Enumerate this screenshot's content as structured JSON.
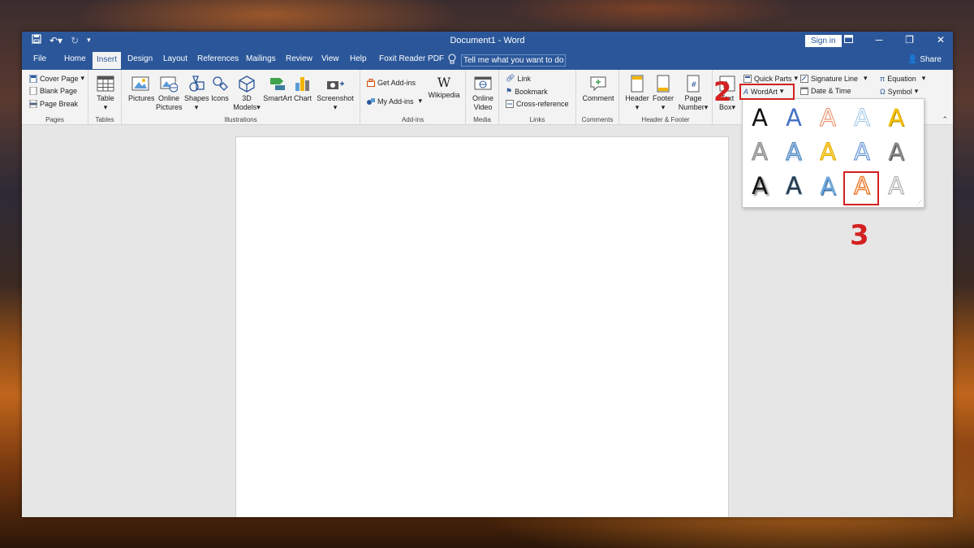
{
  "titlebar": {
    "doc_title": "Document1  -  Word",
    "sign_in": "Sign in"
  },
  "tabs": [
    "File",
    "Home",
    "Insert",
    "Design",
    "Layout",
    "References",
    "Mailings",
    "Review",
    "View",
    "Help",
    "Foxit Reader PDF"
  ],
  "active_tab": "Insert",
  "tell_me": "Tell me what you want to do",
  "share": "Share",
  "groups": {
    "pages": {
      "label": "Pages",
      "items": [
        "Cover Page",
        "Blank Page",
        "Page Break"
      ]
    },
    "tables": {
      "label": "Tables",
      "table": "Table"
    },
    "illustrations": {
      "label": "Illustrations",
      "pictures": "Pictures",
      "online_pictures_1": "Online",
      "online_pictures_2": "Pictures",
      "shapes": "Shapes",
      "icons": "Icons",
      "models_1": "3D",
      "models_2": "Models",
      "smartart": "SmartArt",
      "chart": "Chart",
      "screenshot": "Screenshot"
    },
    "addins": {
      "label": "Add-ins",
      "get": "Get Add-ins",
      "my": "My Add-ins",
      "wikipedia": "Wikipedia"
    },
    "media": {
      "label": "Media",
      "online_1": "Online",
      "online_2": "Video"
    },
    "links": {
      "label": "Links",
      "link": "Link",
      "bookmark": "Bookmark",
      "cross": "Cross-reference"
    },
    "comments": {
      "label": "Comments",
      "comment": "Comment"
    },
    "headerfooter": {
      "label": "Header & Footer",
      "header": "Header",
      "footer": "Footer",
      "pagenum_1": "Page",
      "pagenum_2": "Number"
    },
    "text": {
      "textbox_1": "Text",
      "textbox_2": "Box",
      "quick_parts": "Quick Parts",
      "wordart": "WordArt",
      "signature": "Signature Line",
      "datetime": "Date & Time"
    },
    "symbols": {
      "equation": "Equation",
      "symbol": "Symbol"
    }
  },
  "annotations": {
    "step2": "2",
    "step3": "3"
  },
  "colors": {
    "accent": "#2b579a",
    "highlight": "#d32020"
  }
}
